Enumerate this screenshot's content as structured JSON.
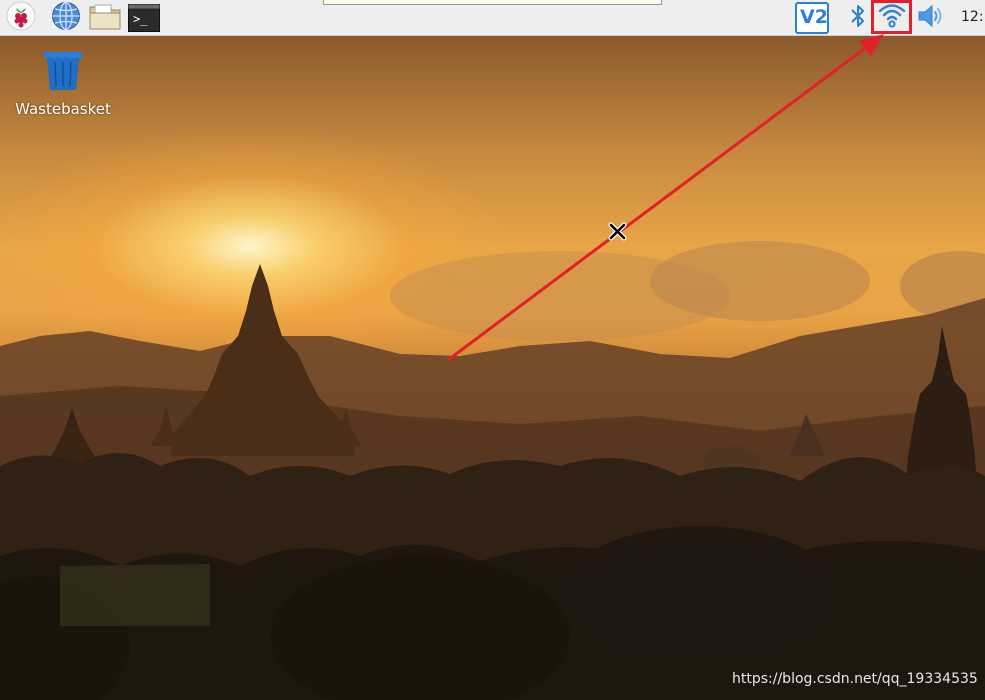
{
  "taskbar": {
    "menu_icon": "raspberry-pi-icon",
    "browser_icon": "globe-icon",
    "files_icon": "folder-icon",
    "terminal_icon": "terminal-icon",
    "terminal_glyph": ">_",
    "tray": {
      "vnc_icon": "vnc-icon",
      "vnc_label": "V2",
      "bluetooth_icon": "bluetooth-icon",
      "wifi_icon": "wifi-icon",
      "volume_icon": "volume-icon",
      "clock": "12:"
    }
  },
  "desktop": {
    "icons": [
      {
        "label": "Wastebasket",
        "icon": "trash-icon"
      }
    ]
  },
  "annotation": {
    "arrow_color": "#e0202a",
    "highlight": "wifi-icon"
  },
  "watermark": "https://blog.csdn.net/qq_19334535",
  "colors": {
    "panel_bg": "#eeeeee",
    "accent_blue": "#2f7fd6",
    "annotation_red": "#e0202a"
  }
}
